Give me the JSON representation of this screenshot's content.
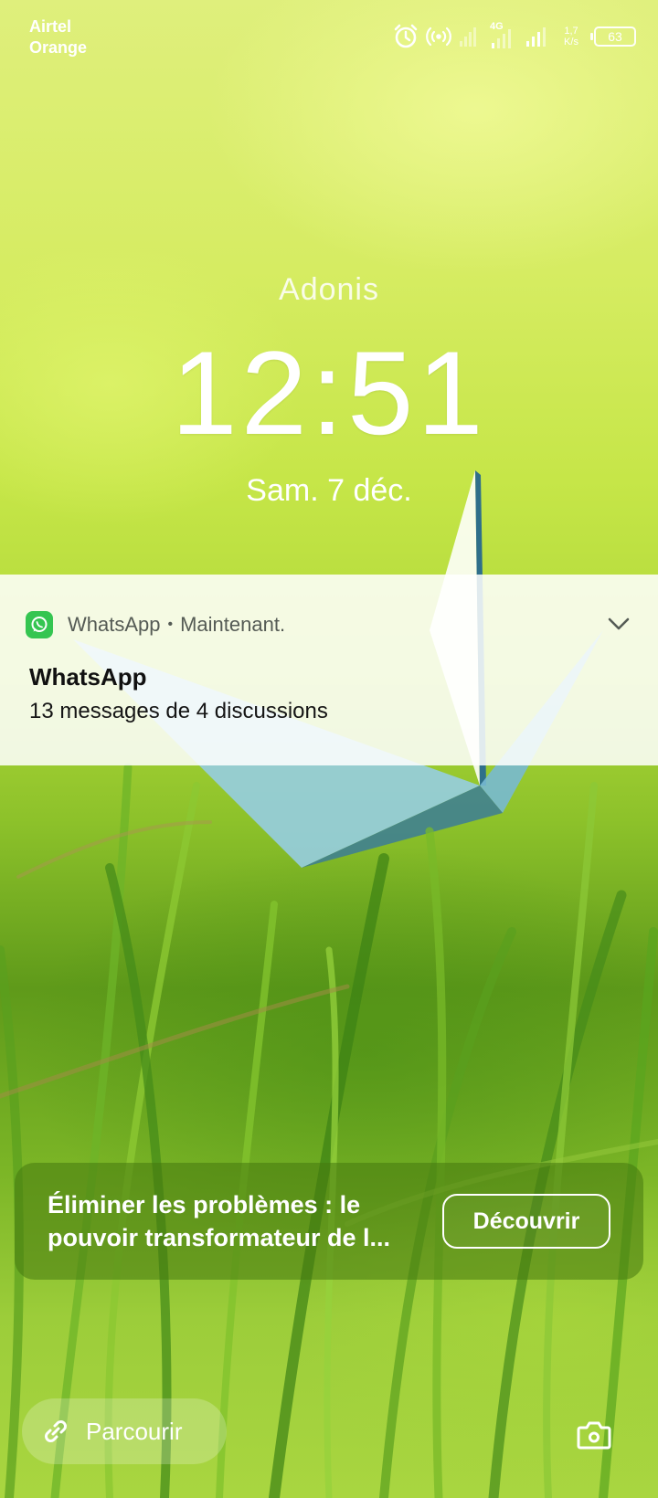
{
  "status_bar": {
    "carrier_1": "Airtel",
    "carrier_2": "Orange",
    "network_type": "4G",
    "speed_value": "1,7",
    "speed_unit": "K/s",
    "battery_level": "63",
    "icons": [
      "alarm-icon",
      "hotspot-icon",
      "signal-icon",
      "signal-icon",
      "battery-icon"
    ]
  },
  "lock_screen": {
    "owner_name": "Adonis",
    "time": "12:51",
    "date": "Sam. 7 déc."
  },
  "notification": {
    "app_name": "WhatsApp",
    "separator": "•",
    "timestamp": "Maintenant.",
    "title": "WhatsApp",
    "body": "13 messages de 4 discussions",
    "accent_color": "#35c551"
  },
  "promo": {
    "line_1": "Éliminer les problèmes : le",
    "line_2": "pouvoir transformateur de l...",
    "button_label": "Découvrir"
  },
  "bottom": {
    "browse_label": "Parcourir",
    "browse_icon": "link-icon",
    "camera_icon": "camera-icon"
  }
}
